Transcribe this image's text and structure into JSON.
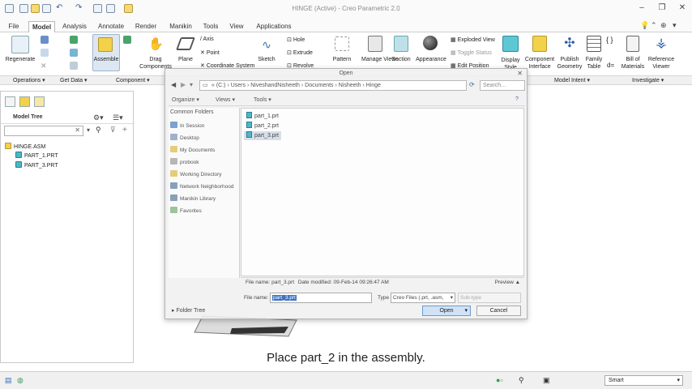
{
  "window": {
    "title": "HINGE (Active) - Creo Parametric 2.0",
    "minimize": "–",
    "restore": "❐",
    "close": "✕"
  },
  "tabs": [
    "File",
    "Model",
    "Analysis",
    "Annotate",
    "Render",
    "Manikin",
    "Tools",
    "View",
    "Applications"
  ],
  "active_tab": "Model",
  "ribbon": {
    "regenerate": "Regenerate",
    "assemble": "Assemble",
    "drag_components": "Drag Components",
    "plane": "Plane",
    "axis": "Axis",
    "point": "Point",
    "coordinate_system": "Coordinate System",
    "sketch": "Sketch",
    "hole": "Hole",
    "extrude": "Extrude",
    "revolve": "Revolve",
    "pattern": "Pattern",
    "manage_views": "Manage Views",
    "section": "Section",
    "appearance": "Appearance",
    "exploded_view": "Exploded View",
    "toggle_status": "Toggle Status",
    "edit_position": "Edit Position",
    "display_style": "Display Style",
    "component_interface": "Component Interface",
    "publish_geometry": "Publish Geometry",
    "family_table": "Family Table",
    "bill_of_materials": "Bill of Materials",
    "reference_viewer": "Reference Viewer",
    "d_symbol": "d="
  },
  "groups": {
    "operations": "Operations ▾",
    "get_data": "Get Data ▾",
    "component": "Component ▾",
    "model_intent": "Model Intent ▾",
    "investigate": "Investigate ▾"
  },
  "model_tree": {
    "title": "Model Tree",
    "items": [
      "HINGE.ASM",
      "PART_1.PRT",
      "PART_3.PRT"
    ]
  },
  "caption": "Place part_2 in the assembly.",
  "statusbar": {
    "filter": "Smart"
  },
  "dialog": {
    "title": "Open",
    "address": "« (C:) › Users › NiveshandNisheeth › Documents › Nisheeth › Hinge",
    "search_placeholder": "Search...",
    "organize": "Organize ▾",
    "views": "Views ▾",
    "tools": "Tools ▾",
    "common_folders_title": "Common Folders",
    "common_folders": [
      "In Session",
      "Desktop",
      "My Documents",
      "probook",
      "Working Directory",
      "Network Neighborhood",
      "Manikin Library",
      "Favorites"
    ],
    "files": [
      "part_1.prt",
      "part_2.prt",
      "part_3.prt"
    ],
    "selected_file": "part_3.prt",
    "file_info_name_label": "File name:",
    "file_info_name": "part_3.prt",
    "file_info_date_label": "Date modified:",
    "file_info_date": "09-Feb-14 09:26:47 AM",
    "preview": "Preview ▲",
    "file_name_label": "File name:",
    "file_name_value": "part_3.prt",
    "type_label": "Type",
    "type_value": "Creo Files (.prt, .asm,",
    "subtype_placeholder": "Sub-type",
    "folder_tree": "Folder Tree",
    "open_button": "Open",
    "cancel_button": "Cancel"
  }
}
